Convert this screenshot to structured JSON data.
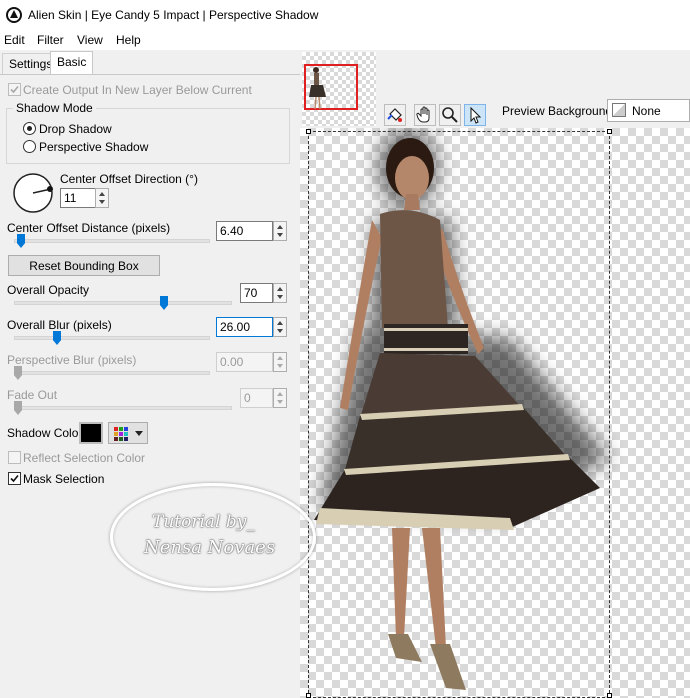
{
  "window": {
    "title": "Alien Skin | Eye Candy 5 Impact | Perspective Shadow"
  },
  "menu": {
    "items": [
      "Edit",
      "Filter",
      "View",
      "Help"
    ]
  },
  "tabs": {
    "settings": "Settings",
    "basic": "Basic"
  },
  "basic": {
    "create_output": {
      "label": "Create Output In New Layer Below Current",
      "checked": true,
      "enabled": false
    },
    "shadow_mode": {
      "title": "Shadow Mode",
      "drop_shadow": "Drop Shadow",
      "perspective_shadow": "Perspective Shadow",
      "selected": "Drop Shadow"
    },
    "center_offset_direction": {
      "label": "Center Offset Direction (°)",
      "value": "11"
    },
    "center_offset_distance": {
      "label": "Center Offset Distance (pixels)",
      "value": "6.40",
      "slider_fraction": 0.05
    },
    "reset_bounding_box": "Reset Bounding Box",
    "overall_opacity": {
      "label": "Overall Opacity",
      "value": "70",
      "slider_fraction": 0.7
    },
    "overall_blur": {
      "label": "Overall Blur (pixels)",
      "value": "26.00",
      "slider_fraction": 0.2
    },
    "perspective_blur": {
      "label": "Perspective Blur (pixels)",
      "value": "0.00",
      "enabled": false
    },
    "fade_out": {
      "label": "Fade Out",
      "value": "0",
      "enabled": false
    },
    "shadow_color": {
      "label": "Shadow Color",
      "color": "#000000"
    },
    "reflect_selection_color": {
      "label": "Reflect Selection Color",
      "checked": false,
      "enabled": false
    },
    "mask_selection": {
      "label": "Mask Selection",
      "checked": true
    }
  },
  "preview": {
    "background_label": "Preview Background:",
    "background_value": "None"
  },
  "watermark": {
    "line1": "Tutorial by_",
    "line2": "Nensa Novaes"
  },
  "colors": {
    "accent": "#0078d7",
    "navigator_frame": "#e02020"
  },
  "icons": [
    "app-logo-icon",
    "bucket-tool-icon",
    "hand-tool-icon",
    "zoom-tool-icon",
    "pointer-tool-icon",
    "color-grid-icon",
    "dropdown-arrow-icon"
  ]
}
